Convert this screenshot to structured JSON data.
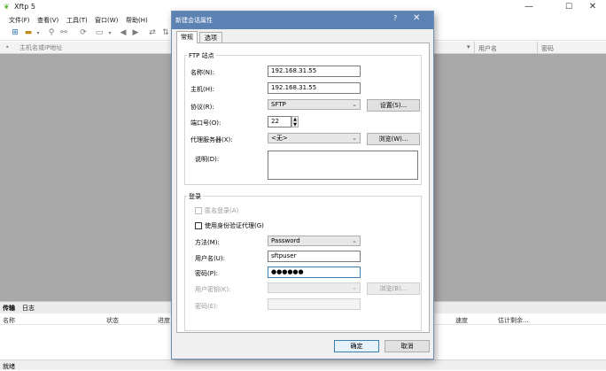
{
  "app": {
    "title": "Xftp 5",
    "logo_icon": "xftp-logo-icon"
  },
  "window_controls": {
    "minimize": "—",
    "maximize": "☐",
    "close": "✕"
  },
  "menubar": [
    {
      "label": "文件(F)"
    },
    {
      "label": "查看(V)"
    },
    {
      "label": "工具(T)"
    },
    {
      "label": "窗口(W)"
    },
    {
      "label": "帮助(H)"
    }
  ],
  "address_bar": {
    "placeholder": "主机名或IP地址",
    "col_user": "用户名",
    "col_password": "密码"
  },
  "transfer": {
    "tabs": [
      "传输",
      "日志"
    ],
    "columns": {
      "name": "名称",
      "status": "状态",
      "progress": "进度",
      "speed": "速度",
      "eta": "估计剩余..."
    }
  },
  "statusbar": {
    "text": "就绪"
  },
  "dialog": {
    "title": "新建会话属性",
    "help": "?",
    "close": "✕",
    "tabs": [
      "常规",
      "选项"
    ],
    "ftp_group": {
      "title": "FTP 站点",
      "name_label": "名称(N):",
      "name_value": "192.168.31.55",
      "host_label": "主机(H):",
      "host_value": "192.168.31.55",
      "protocol_label": "协议(R):",
      "protocol_value": "SFTP",
      "settings_button": "设置(S)...",
      "port_label": "端口号(O):",
      "port_value": "22",
      "proxy_label": "代理服务器(X):",
      "proxy_value": "<无>",
      "browse_button": "浏览(W)...",
      "desc_label": "说明(D):",
      "desc_value": ""
    },
    "login_group": {
      "title": "登录",
      "anonymous_label": "匿名登录(A)",
      "auth_agent_label": "使用身份验证代理(G)",
      "method_label": "方法(M):",
      "method_value": "Password",
      "user_label": "用户名(U):",
      "user_value": "sftpuser",
      "password_label": "密码(P):",
      "password_value": "●●●●●●",
      "user_key_label": "用户密钥(K):",
      "user_key_value": "",
      "browse_button": "浏览(B)...",
      "passphrase_label": "密码(E):",
      "passphrase_value": ""
    },
    "ok_button": "确定",
    "cancel_button": "取消"
  }
}
